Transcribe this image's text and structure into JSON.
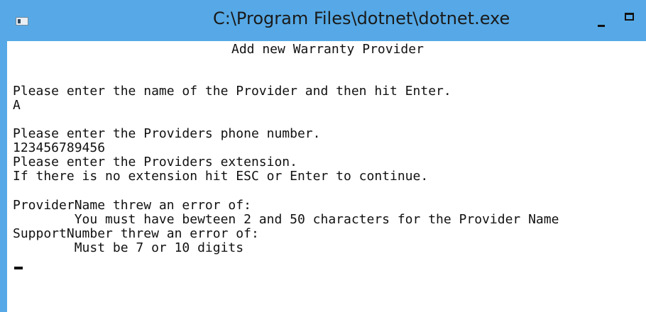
{
  "window": {
    "title": "C:\\Program Files\\dotnet\\dotnet.exe",
    "colors": {
      "titlebar": "#56a9e6",
      "console_background": "#ffffff",
      "console_text": "#111111"
    },
    "icons": {
      "system": "console-app-icon",
      "minimize": "minimize-icon",
      "maximize": "maximize-icon"
    }
  },
  "console": {
    "heading": "Add new Warranty Provider",
    "lines": [
      "Please enter the name of the Provider and then hit Enter.",
      "A",
      "Please enter the Providers phone number.",
      "123456789456",
      "Please enter the Providers extension.",
      "If there is no extension hit ESC or Enter to continue.",
      "ProviderName threw an error of:",
      "        You must have bewteen 2 and 50 characters for the Provider Name",
      "SupportNumber threw an error of:",
      "        Must be 7 or 10 digits"
    ]
  }
}
